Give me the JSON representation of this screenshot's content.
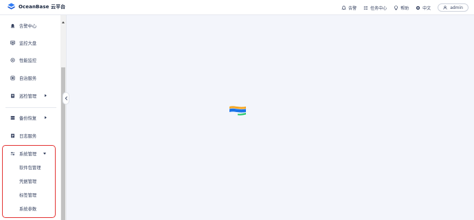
{
  "header": {
    "brand": "OceanBase 云平台",
    "alerts_label": "告警",
    "tasks_label": "任务中心",
    "help_label": "帮助",
    "language_label": "中文",
    "user_label": "admin"
  },
  "sidebar": {
    "items": [
      {
        "label": "告警中心"
      },
      {
        "label": "监控大盘"
      },
      {
        "label": "性能监控"
      },
      {
        "label": "自治服务"
      },
      {
        "label": "巡检管理"
      },
      {
        "label": "备份恢复"
      },
      {
        "label": "日志服务"
      },
      {
        "label": "系统管理"
      }
    ],
    "system_sub_items": [
      {
        "label": "软件包管理"
      },
      {
        "label": "凭据管理"
      },
      {
        "label": "标签管理"
      },
      {
        "label": "系统参数"
      }
    ]
  },
  "colors": {
    "highlight_border": "#e3302f",
    "main_background": "#f3f5fb",
    "brand_blue": "#1a73e8"
  },
  "icons": [
    "oceanbase-logo",
    "bell-icon",
    "tasks-icon",
    "help-icon",
    "globe-icon",
    "user-icon",
    "chevron-left-icon",
    "loading-logo"
  ]
}
